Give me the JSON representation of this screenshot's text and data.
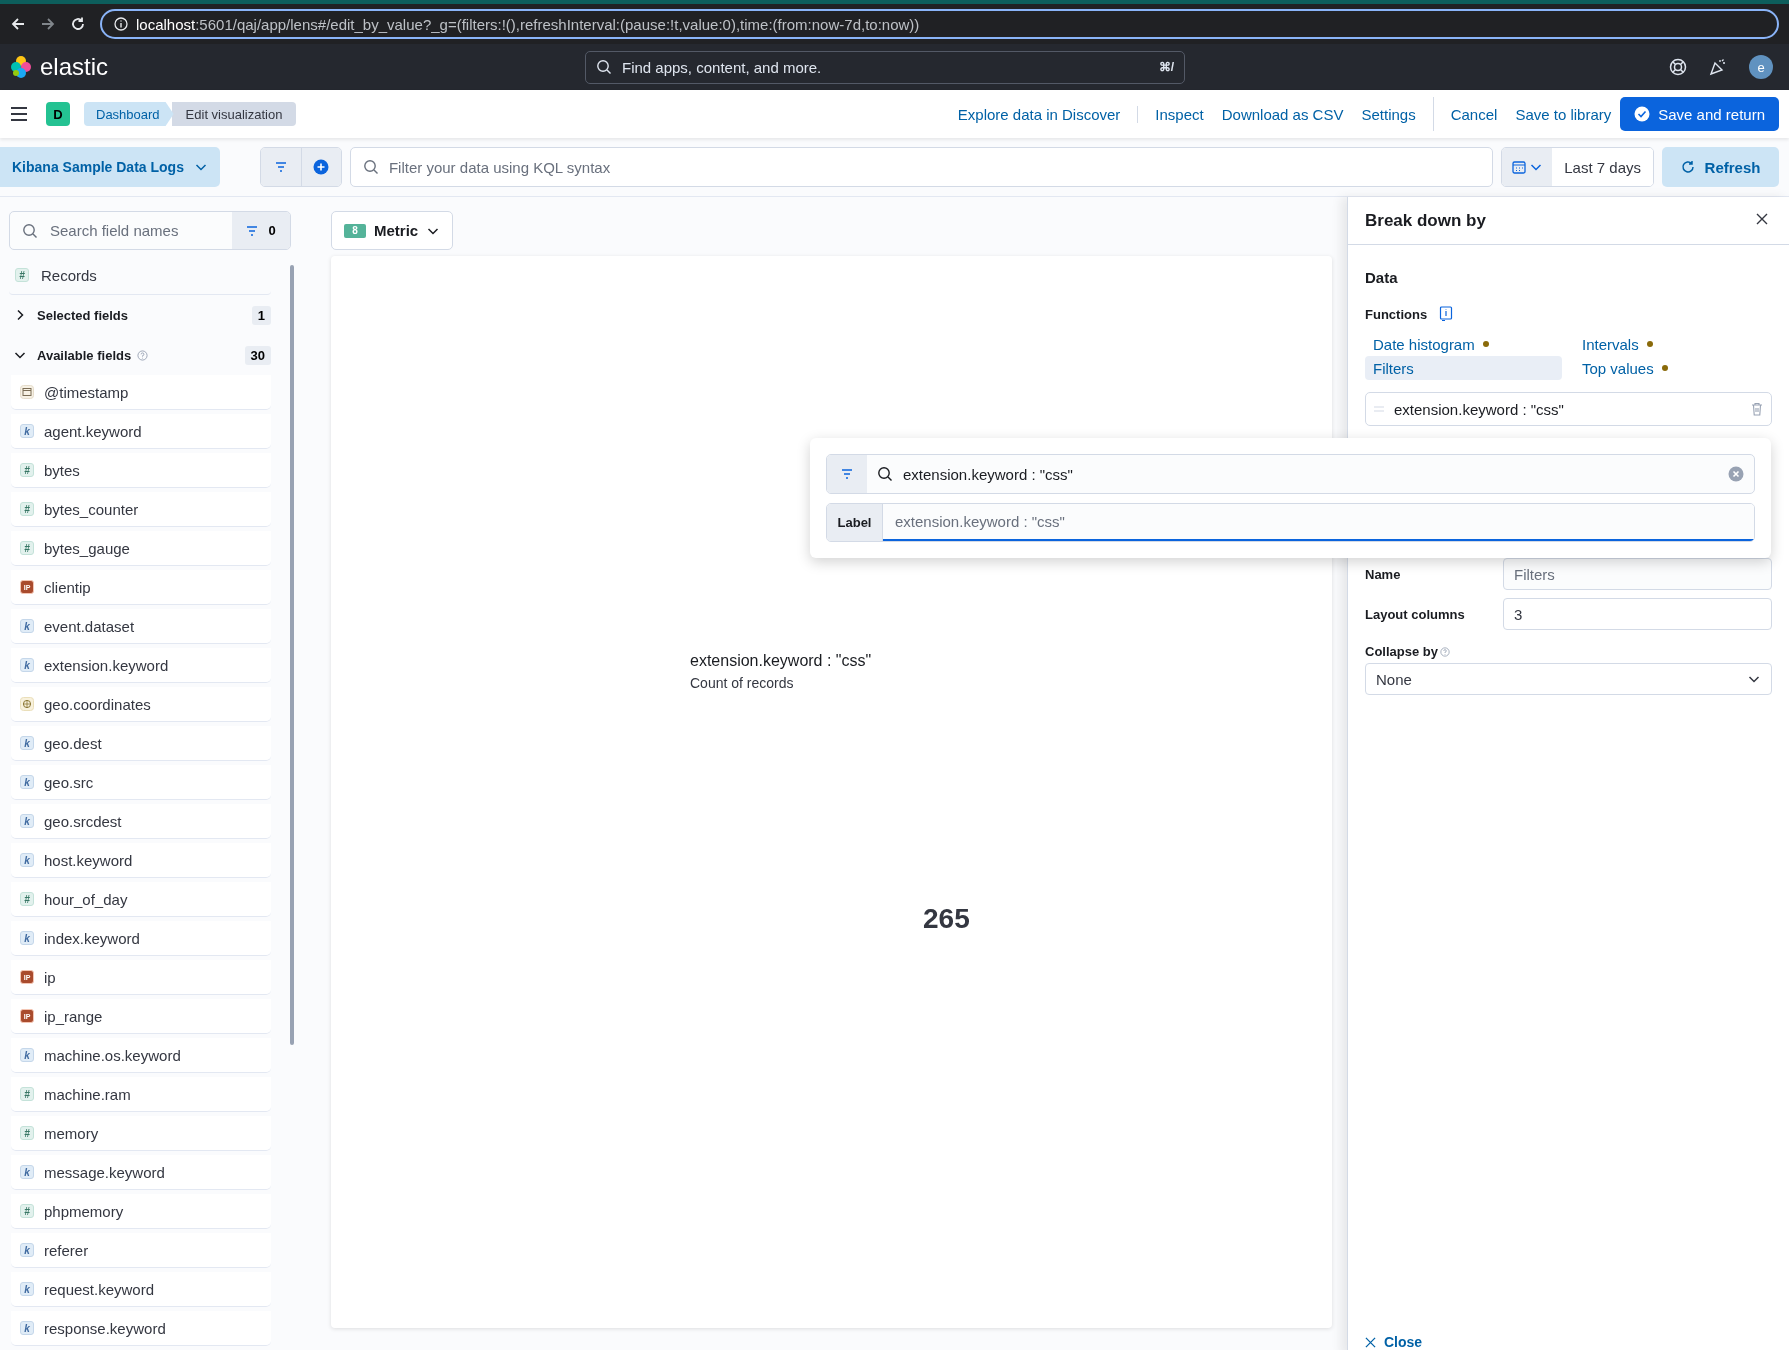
{
  "browser": {
    "url_host": "localhost",
    "url_rest": ":5601/qaj/app/lens#/edit_by_value?_g=(filters:!(),refreshInterval:(pause:!t,value:0),time:(from:now-7d,to:now))"
  },
  "header": {
    "brand": "elastic",
    "search_placeholder": "Find apps, content, and more.",
    "shortcut": "⌘/",
    "avatar": "e"
  },
  "toolbar": {
    "app_badge": "D",
    "breadcrumbs": [
      {
        "label": "Dashboard",
        "kind": "link"
      },
      {
        "label": "Edit visualization",
        "kind": "current"
      }
    ],
    "action_groups": [
      [
        {
          "label": "Explore data in Discover",
          "kind": "link"
        }
      ],
      [
        {
          "label": "Inspect",
          "kind": "link"
        },
        {
          "label": "Download as CSV",
          "kind": "link"
        },
        {
          "label": "Settings",
          "kind": "link"
        }
      ],
      [
        {
          "label": "Cancel",
          "kind": "link"
        },
        {
          "label": "Save to library",
          "kind": "link"
        },
        {
          "label": "Save and return",
          "kind": "primary"
        }
      ]
    ]
  },
  "query": {
    "data_view": "Kibana Sample Data Logs",
    "placeholder": "Filter your data using KQL syntax",
    "date_range": "Last 7 days",
    "refresh": "Refresh"
  },
  "sidebar": {
    "search_placeholder": "Search field names",
    "filter_count": "0",
    "records": {
      "name": "Records",
      "badge": "#"
    },
    "sections": [
      {
        "label": "Selected fields",
        "count": "1",
        "expanded": false,
        "help": false
      },
      {
        "label": "Available fields",
        "count": "30",
        "expanded": true,
        "help": true
      }
    ],
    "fields": [
      {
        "name": "@timestamp",
        "kind": "date"
      },
      {
        "name": "agent.keyword",
        "kind": "keyword",
        "badge": "k"
      },
      {
        "name": "bytes",
        "kind": "number",
        "badge": "#"
      },
      {
        "name": "bytes_counter",
        "kind": "number",
        "badge": "#"
      },
      {
        "name": "bytes_gauge",
        "kind": "number",
        "badge": "#"
      },
      {
        "name": "clientip",
        "kind": "ip",
        "badge": "IP"
      },
      {
        "name": "event.dataset",
        "kind": "keyword",
        "badge": "k"
      },
      {
        "name": "extension.keyword",
        "kind": "keyword",
        "badge": "k"
      },
      {
        "name": "geo.coordinates",
        "kind": "geo"
      },
      {
        "name": "geo.dest",
        "kind": "keyword",
        "badge": "k"
      },
      {
        "name": "geo.src",
        "kind": "keyword",
        "badge": "k"
      },
      {
        "name": "geo.srcdest",
        "kind": "keyword",
        "badge": "k"
      },
      {
        "name": "host.keyword",
        "kind": "keyword",
        "badge": "k"
      },
      {
        "name": "hour_of_day",
        "kind": "number",
        "badge": "#"
      },
      {
        "name": "index.keyword",
        "kind": "keyword",
        "badge": "k"
      },
      {
        "name": "ip",
        "kind": "ip",
        "badge": "IP"
      },
      {
        "name": "ip_range",
        "kind": "ip",
        "badge": "IP"
      },
      {
        "name": "machine.os.keyword",
        "kind": "keyword",
        "badge": "k"
      },
      {
        "name": "machine.ram",
        "kind": "number",
        "badge": "#"
      },
      {
        "name": "memory",
        "kind": "number",
        "badge": "#"
      },
      {
        "name": "message.keyword",
        "kind": "keyword",
        "badge": "k"
      },
      {
        "name": "phpmemory",
        "kind": "number",
        "badge": "#"
      },
      {
        "name": "referer",
        "kind": "keyword",
        "badge": "k"
      },
      {
        "name": "request.keyword",
        "kind": "keyword",
        "badge": "k"
      },
      {
        "name": "response.keyword",
        "kind": "keyword",
        "badge": "k"
      }
    ]
  },
  "workspace": {
    "chart_type": "Metric",
    "chart_badge": "8",
    "metric": {
      "title": "extension.keyword : \"css\"",
      "subtitle": "Count of records",
      "value": "265"
    }
  },
  "flyout": {
    "title": "Break down by",
    "section": "Data",
    "functions_label": "Functions",
    "functions": [
      {
        "label": "Date histogram",
        "selected": false,
        "warning": true
      },
      {
        "label": "Intervals",
        "selected": false,
        "warning": true
      },
      {
        "label": "Filters",
        "selected": true,
        "warning": false
      },
      {
        "label": "Top values",
        "selected": false,
        "warning": true
      }
    ],
    "filter_item": "extension.keyword : \"css\"",
    "name_label": "Name",
    "name_value": "Filters",
    "layout_columns_label": "Layout columns",
    "layout_columns_value": "3",
    "collapse_label": "Collapse by",
    "collapse_value": "None",
    "close": "Close"
  },
  "popover": {
    "query": "extension.keyword : \"css\"",
    "label_label": "Label",
    "label_placeholder": "extension.keyword : \"css\""
  }
}
